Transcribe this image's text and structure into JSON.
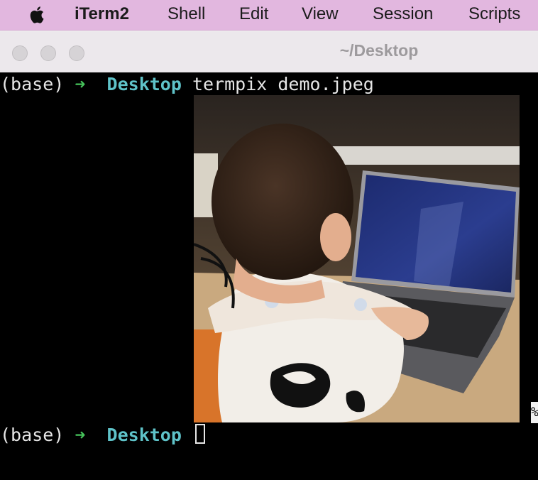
{
  "menubar": {
    "app_name": "iTerm2",
    "items": [
      "Shell",
      "Edit",
      "View",
      "Session",
      "Scripts"
    ]
  },
  "window": {
    "title": "~/Desktop"
  },
  "terminal": {
    "lines": [
      {
        "env": "(base)",
        "arrow": "➜",
        "dir": "Desktop",
        "command": "termpix demo.jpeg"
      },
      {
        "env": "(base)",
        "arrow": "➜",
        "dir": "Desktop",
        "command": ""
      }
    ],
    "overflow_char": "%"
  },
  "colors": {
    "menubar": "#e2b7df",
    "prompt_arrow": "#46c35b",
    "prompt_dir": "#5fc3c9"
  },
  "image": {
    "description_icon": "photo-of-child-at-laptop"
  }
}
